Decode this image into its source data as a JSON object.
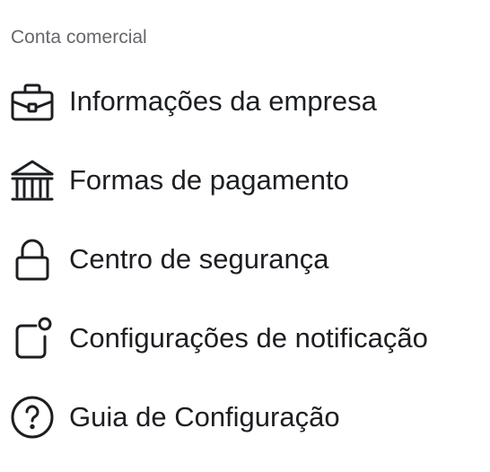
{
  "section": {
    "title": "Conta comercial"
  },
  "menu": {
    "items": [
      {
        "label": "Informações da empresa",
        "icon": "briefcase-icon"
      },
      {
        "label": "Formas de pagamento",
        "icon": "bank-icon"
      },
      {
        "label": "Centro de segurança",
        "icon": "lock-icon"
      },
      {
        "label": "Configurações de notificação",
        "icon": "notification-icon"
      },
      {
        "label": "Guia de Configuração",
        "icon": "help-icon"
      }
    ]
  }
}
